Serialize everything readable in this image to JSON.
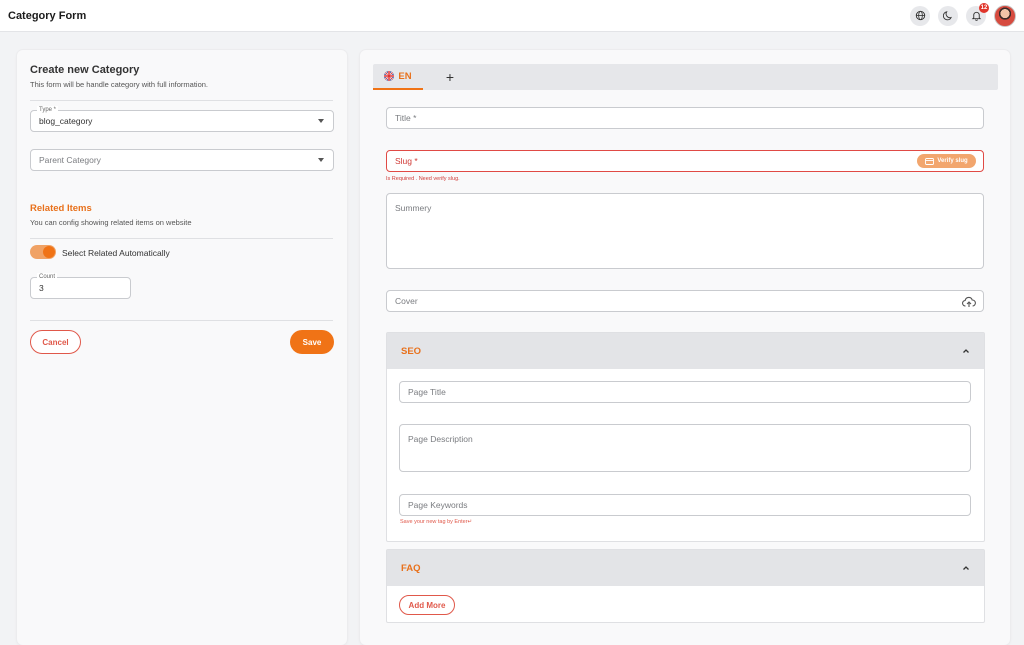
{
  "app": {
    "title": "Category Form"
  },
  "topbar": {
    "icons": [
      "globe-icon",
      "moon-icon",
      "bell-icon"
    ],
    "notification_count": "12"
  },
  "left": {
    "title": "Create new Category",
    "subtitle": "This form will be handle category with full information.",
    "type_label": "Type *",
    "type_value": "blog_category",
    "parent_placeholder": "Parent Category",
    "related_title": "Related Items",
    "related_sub": "You can config showing related items on website",
    "toggle_label": "Select Related Automatically",
    "toggle_on": true,
    "count_label": "Count",
    "count_value": "3",
    "cancel_label": "Cancel",
    "save_label": "Save"
  },
  "right": {
    "tab_label": "EN",
    "add_tab_symbol": "+",
    "title_placeholder": "Title *",
    "slug_placeholder": "Slug *",
    "verify_label": "Verify slug",
    "slug_error": "Is Required . Need verify slug.",
    "summary_placeholder": "Summery",
    "cover_placeholder": "Cover",
    "seo": {
      "title": "SEO",
      "page_title_placeholder": "Page Title",
      "page_description_placeholder": "Page Description",
      "page_keywords_placeholder": "Page Keywords",
      "keywords_hint": "Save your new tag by Enter↵"
    },
    "faq": {
      "title": "FAQ",
      "add_more_label": "Add More"
    }
  },
  "colors": {
    "accent": "#f07316",
    "error": "#d03b37"
  }
}
